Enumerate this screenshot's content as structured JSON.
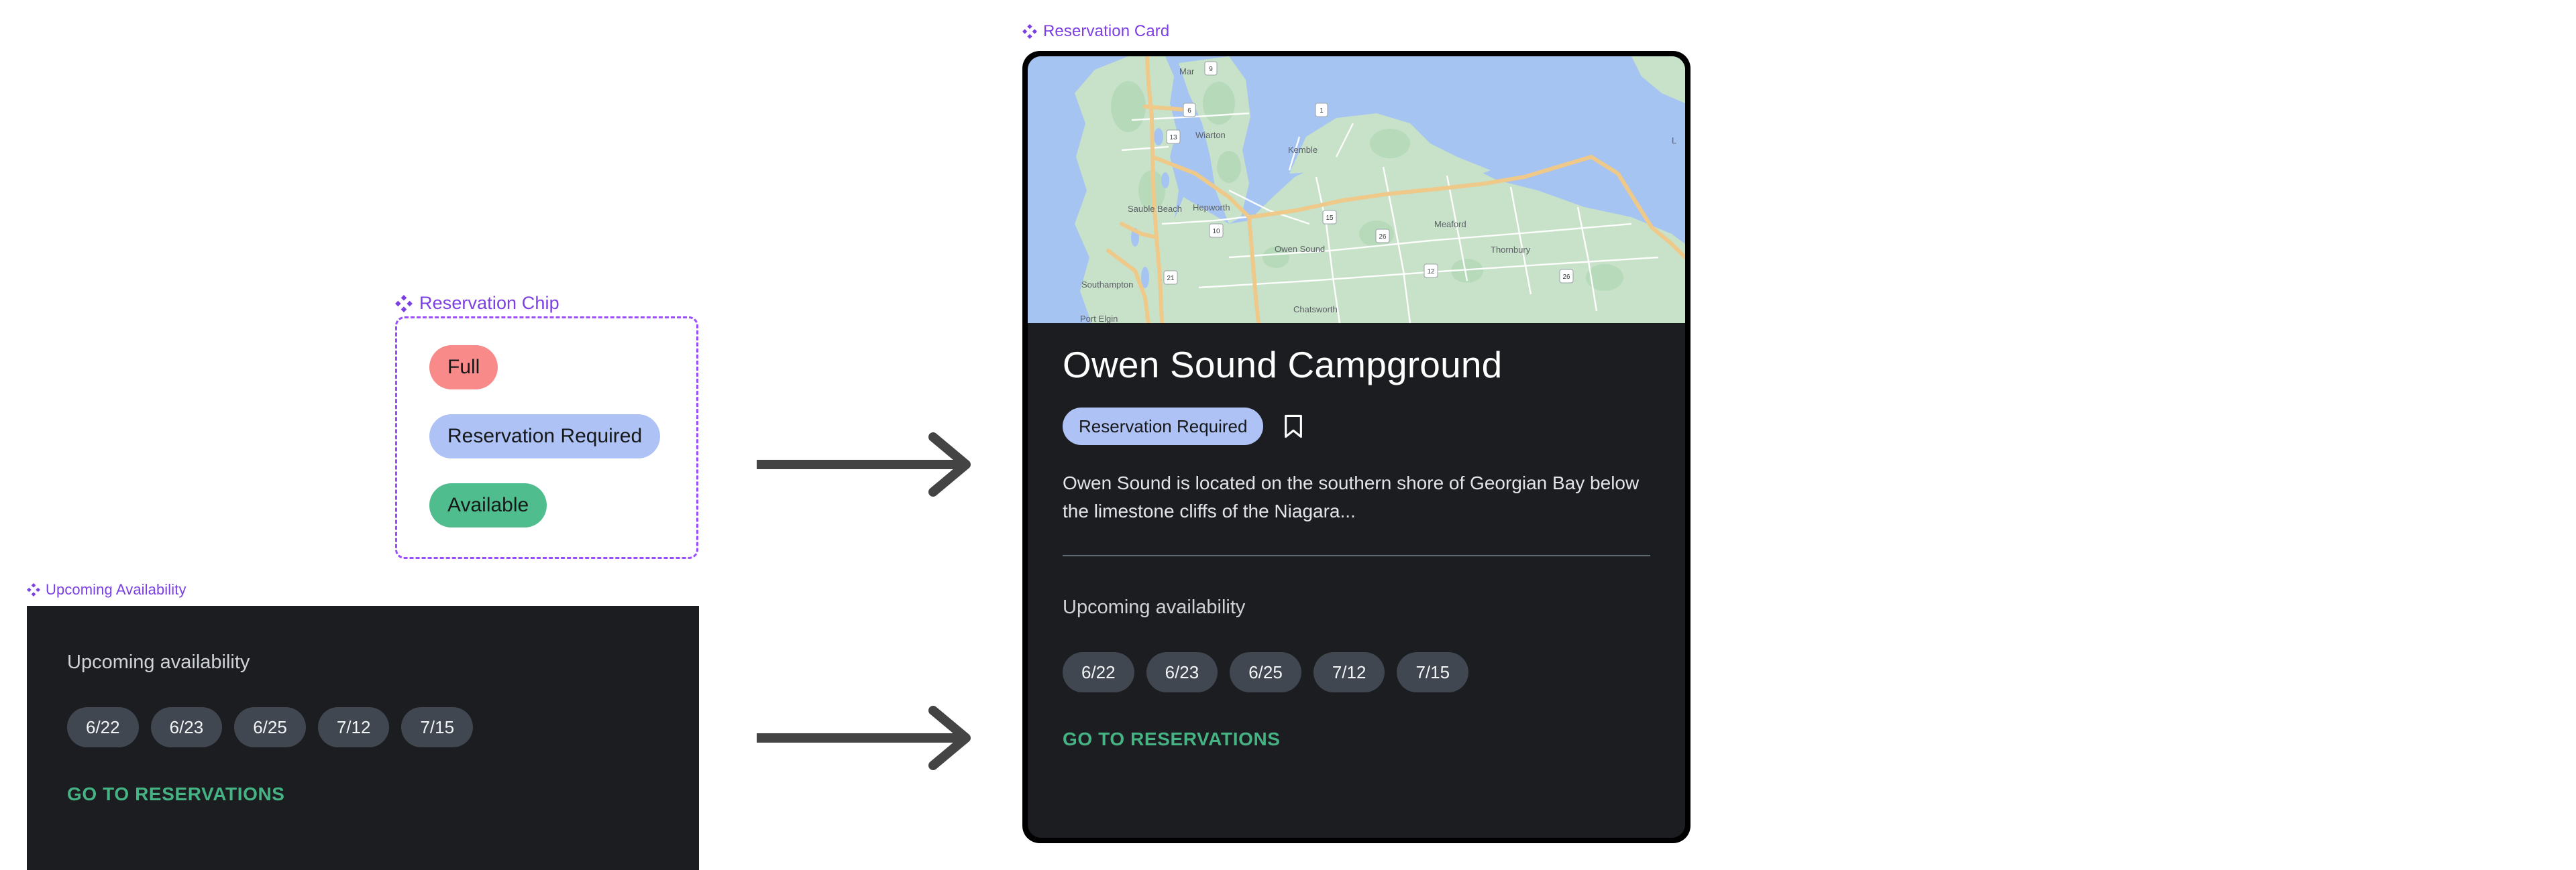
{
  "page": {
    "background": "#ffffff",
    "accent_purple": "#7b3fe4",
    "dark_surface": "#1b1d20",
    "cta_green": "#45b384"
  },
  "labels": {
    "reservation_chip": "Reservation Chip",
    "upcoming_availability": "Upcoming Availability",
    "reservation_card": "Reservation Card",
    "component_icon": "figma-component-icon"
  },
  "chip_frame": {
    "chips": [
      {
        "label": "Full",
        "color": "#f98a8a",
        "name": "chip-full"
      },
      {
        "label": "Reservation Required",
        "color": "#aec2f5",
        "name": "chip-reservation-required"
      },
      {
        "label": "Available",
        "color": "#4fbd8e",
        "name": "chip-available"
      }
    ]
  },
  "availability_panel": {
    "heading": "Upcoming availability",
    "dates": [
      "6/22",
      "6/23",
      "6/25",
      "7/12",
      "7/15"
    ],
    "cta_label": "GO TO RESERVATIONS",
    "chip_bg": "#414750"
  },
  "arrows": {
    "icon": "arrow-right-icon",
    "color": "#444444",
    "count": 2
  },
  "reservation_card": {
    "map": {
      "icon": "map-preview",
      "water_color": "#a5c4f2",
      "land_color": "#c8e2c9",
      "road_color": "#f3cf8d",
      "place_labels": [
        "Mar",
        "Wiarton",
        "Kemble",
        "Sauble Beach",
        "Hepworth",
        "Owen Sound",
        "Meaford",
        "Thornbury",
        "Southampton",
        "Chatsworth",
        "Port Elgin"
      ],
      "route_shields": [
        "9",
        "6",
        "1",
        "13",
        "15",
        "10",
        "26",
        "12",
        "21",
        "26"
      ]
    },
    "title": "Owen Sound Campground",
    "badge": {
      "label": "Reservation Required",
      "color": "#aec2f5"
    },
    "bookmark_icon": "bookmark-icon",
    "description": "Owen Sound is located on the southern shore of Georgian Bay below the limestone cliffs of the Niagara...",
    "availability_heading": "Upcoming availability",
    "availability_dates": [
      "6/22",
      "6/23",
      "6/25",
      "7/12",
      "7/15"
    ],
    "cta_label": "GO TO RESERVATIONS"
  }
}
